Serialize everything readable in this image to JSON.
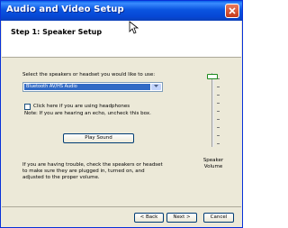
{
  "window": {
    "title": "Audio and Video Setup"
  },
  "header": {
    "step_title": "Step 1: Speaker Setup"
  },
  "speakers": {
    "select_label": "Select the speakers or headset you would like to use:",
    "selected_device": "Bluetooth AV/HS Audio"
  },
  "headphones": {
    "checkbox_label": "Click here if you are using headphones",
    "note": "Note: If you are hearing an echo, uncheck this box.",
    "checked": false
  },
  "play_button": {
    "label": "Play Sound"
  },
  "trouble_text": [
    "If you are having trouble, check the speakers or headset",
    "to make sure they are plugged in, turned on, and",
    "adjusted to the proper volume."
  ],
  "volume": {
    "label_line1": "Speaker",
    "label_line2": "Volume",
    "level_fraction": 0.95
  },
  "nav": {
    "back_label": "< Back",
    "next_label": "Next >",
    "cancel_label": "Cancel"
  }
}
